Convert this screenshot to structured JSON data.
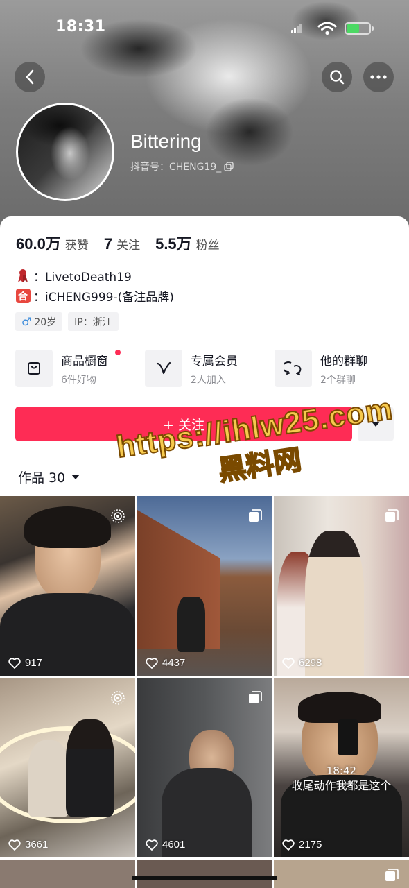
{
  "status_bar": {
    "time": "18:31"
  },
  "profile": {
    "name": "Bittering",
    "douyin_id": "抖音号：CHENG19_"
  },
  "stats": [
    {
      "value": "60.0万",
      "label": "获赞"
    },
    {
      "value": "7",
      "label": "关注"
    },
    {
      "value": "5.5万",
      "label": "粉丝"
    }
  ],
  "bio": [
    {
      "icon": "ribbon-icon",
      "text": "：LivetoDeath19"
    },
    {
      "icon": "cooperation-icon",
      "text": "：iCHENG999-(备注品牌)"
    }
  ],
  "tags": [
    {
      "icon": "male-icon",
      "text": "20岁"
    },
    {
      "text": "IP：浙江"
    }
  ],
  "features": [
    {
      "icon": "shopping-bag-icon",
      "title": "商品橱窗",
      "subtitle": "6件好物",
      "badge": true
    },
    {
      "icon": "vip-icon",
      "title": "专属会员",
      "subtitle": "2人加入"
    },
    {
      "icon": "group-chat-icon",
      "title": "他的群聊",
      "subtitle": "2个群聊"
    }
  ],
  "actions": {
    "follow_label": "+ 关注"
  },
  "works": {
    "tab_label": "作品 30"
  },
  "videos": [
    {
      "likes": "917",
      "corner": "live-photo-icon"
    },
    {
      "likes": "4437",
      "corner": "gallery-icon"
    },
    {
      "likes": "6298",
      "corner": "gallery-icon"
    },
    {
      "likes": "3661",
      "corner": "live-photo-icon"
    },
    {
      "likes": "4601",
      "corner": "gallery-icon"
    },
    {
      "likes": "2175",
      "caption_time": "18:42",
      "caption_text": "收尾动作我都是这个"
    }
  ],
  "watermark": {
    "url": "https://ihlw25.com",
    "name": "黑料网"
  },
  "colors": {
    "accent": "#fe2c55",
    "tag_bg": "#f2f2f4",
    "watermark": "#f6c94d"
  }
}
